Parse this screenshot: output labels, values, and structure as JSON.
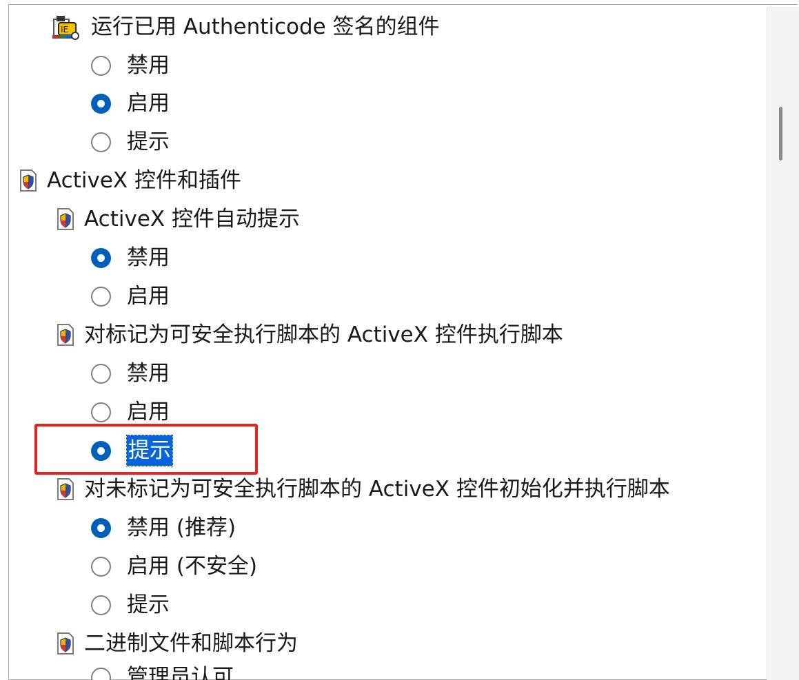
{
  "settings": {
    "authenticode": {
      "label": "运行已用 Authenticode 签名的组件",
      "icon": "certificate-icon",
      "options": [
        {
          "label": "禁用",
          "checked": false
        },
        {
          "label": "启用",
          "checked": true
        },
        {
          "label": "提示",
          "checked": false
        }
      ]
    },
    "activex": {
      "label": "ActiveX 控件和插件",
      "icon": "security-page-icon",
      "auto_prompt": {
        "label": "ActiveX 控件自动提示",
        "options": [
          {
            "label": "禁用",
            "checked": true
          },
          {
            "label": "启用",
            "checked": false
          }
        ]
      },
      "script_safe": {
        "label": "对标记为可安全执行脚本的 ActiveX 控件执行脚本",
        "options": [
          {
            "label": "禁用",
            "checked": false
          },
          {
            "label": "启用",
            "checked": false
          },
          {
            "label": "提示",
            "checked": true,
            "selected": true
          }
        ]
      },
      "init_unsafe": {
        "label": "对未标记为可安全执行脚本的 ActiveX 控件初始化并执行脚本",
        "options": [
          {
            "label": "禁用 (推荐)",
            "checked": true
          },
          {
            "label": "启用 (不安全)",
            "checked": false
          },
          {
            "label": "提示",
            "checked": false
          }
        ]
      },
      "binary_behaviors": {
        "label": "二进制文件和脚本行为",
        "options": [
          {
            "label": "管理员认可",
            "checked": false
          }
        ]
      }
    }
  },
  "colors": {
    "radio_checked": "#005fb8",
    "selection": "#0a64d8",
    "annotation": "#e8221e",
    "scrollbar": "#8a8a8a"
  }
}
